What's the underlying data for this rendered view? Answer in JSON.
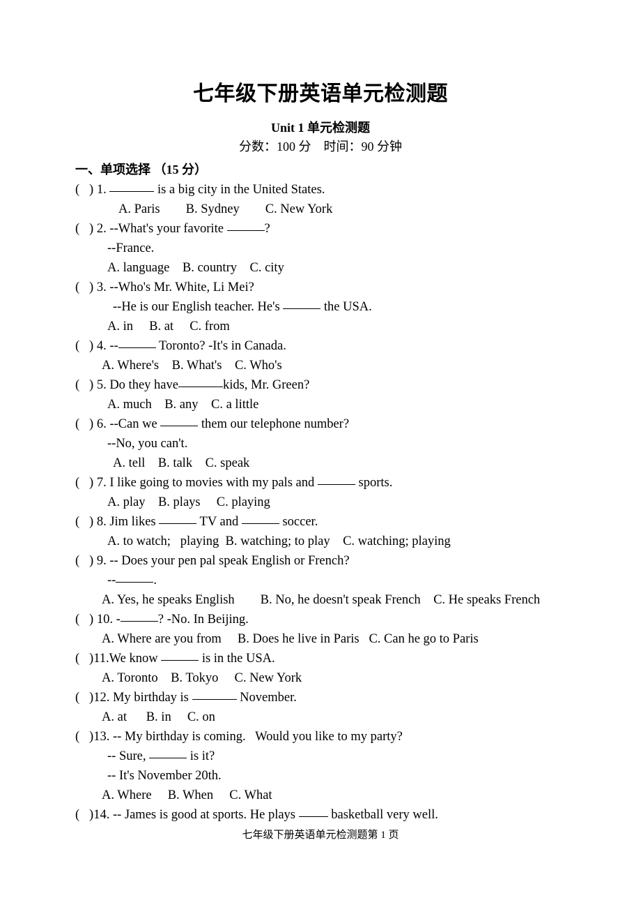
{
  "document": {
    "title": "七年级下册英语单元检测题",
    "subtitle": "Unit 1  单元检测题",
    "meta": "分数：100 分　时间：90 分钟",
    "footer": "七年级下册英语单元检测题第 1 页"
  },
  "section": {
    "heading": "一、单项选择 （15 分）"
  },
  "questions": [
    {
      "marker": "(   ) 1. ",
      "stem_before": "",
      "blank": "bl-lg",
      "stem_after": " is a big city in the United States.",
      "options": "A. Paris        B. Sydney        C. New York",
      "options_indent": "ind-4"
    },
    {
      "marker": "(   ) 2. --What's your favorite ",
      "blank": "bl-md",
      "stem_after": "?",
      "reply": "--France.",
      "reply_indent": "ind-2",
      "options": "A. language    B. country    C. city",
      "options_indent": "ind-2"
    },
    {
      "marker": "(   ) 3. --Who's Mr. White, Li Mei?",
      "reply_before": "--He is our English teacher. He's ",
      "reply_blank": "bl-md",
      "reply_after": " the USA.",
      "reply_indent": "ind-3",
      "options": "A. in     B. at     C. from",
      "options_indent": "ind-2"
    },
    {
      "marker": "(   ) 4. --",
      "blank": "bl-md",
      "stem_after": " Toronto? -It's in Canada.",
      "options": "A. Where's    B. What's    C. Who's",
      "options_indent": "ind-1"
    },
    {
      "marker": "(   ) 5. Do they have",
      "blank": "bl-lg",
      "stem_after": "kids, Mr. Green?",
      "options": "A. much    B. any    C. a little",
      "options_indent": "ind-2"
    },
    {
      "marker": "(   ) 6. --Can we ",
      "blank": "bl-md",
      "stem_after": " them our telephone number?",
      "reply": "--No, you can't.",
      "reply_indent": "ind-2",
      "options": "A. tell    B. talk    C. speak",
      "options_indent": "ind-3"
    },
    {
      "marker": "(   ) 7. I like going to movies with my pals and ",
      "blank": "bl-md",
      "stem_after": " sports.",
      "options": "A. play    B. plays     C. playing",
      "options_indent": "ind-2"
    },
    {
      "marker": "(   ) 8. Jim likes ",
      "blank": "bl-md",
      "stem_after": " TV and ",
      "blank2": "bl-md",
      "stem_after2": " soccer.",
      "options": "A. to watch;   playing  B. watching; to play    C. watching; playing",
      "options_indent": "ind-2"
    },
    {
      "marker": "(   ) 9. -- Does your pen pal speak English or French?",
      "reply_before": "--",
      "reply_blank": "bl-md",
      "reply_after": ".",
      "reply_indent": "ind-2",
      "options": "A. Yes, he speaks English        B. No, he doesn't speak French    C. He speaks French",
      "options_indent": "ind-1"
    },
    {
      "marker": "(   ) 10. -",
      "blank": "bl-md",
      "stem_after": "? -No. In Beijing.",
      "options": "A. Where are you from     B. Does he live in Paris   C. Can he go to Paris",
      "options_indent": "ind-1"
    },
    {
      "marker": "(   )11.We know ",
      "blank": "bl-md",
      "stem_after": " is in the USA.",
      "options": "A. Toronto    B. Tokyo     C. New York",
      "options_indent": "ind-1"
    },
    {
      "marker": "(   )12. My birthday is ",
      "blank": "bl-lg",
      "stem_after": " November.",
      "options": "A. at      B. in     C. on",
      "options_indent": "ind-1"
    },
    {
      "marker": "(   )13. -- My birthday is coming.   Would you like to my party?",
      "reply_before": "-- Sure, ",
      "reply_blank": "bl-md",
      "reply_after": " is it?",
      "reply_indent": "ind-2",
      "reply2": "-- It's November 20th.",
      "reply2_indent": "ind-2",
      "options": "A. Where     B. When     C. What",
      "options_indent": "ind-1"
    },
    {
      "marker": "(   )14. -- James is good at sports. He plays ",
      "blank": "bl-sm",
      "stem_after": " basketball very well."
    }
  ]
}
